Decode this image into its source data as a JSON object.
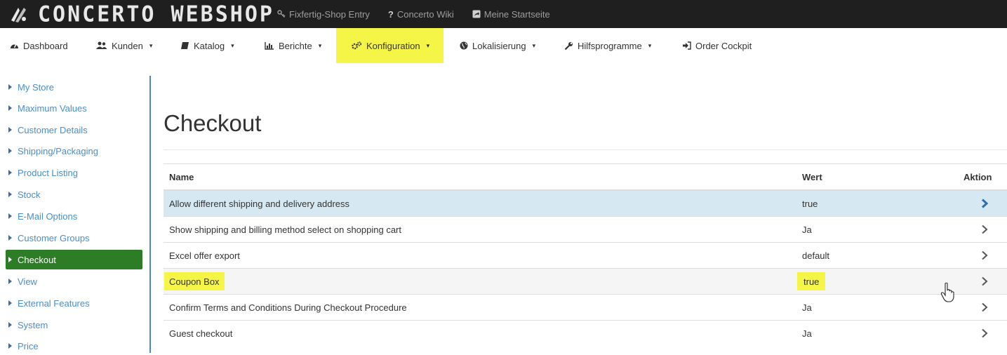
{
  "topbar": {
    "brand": "CONCERTO WEBSHOP",
    "links": [
      {
        "icon": "key-icon",
        "label": "Fixfertig-Shop Entry"
      },
      {
        "icon": "question-icon",
        "label": "Concerto Wiki"
      },
      {
        "icon": "share-icon",
        "label": "Meine Startseite"
      }
    ]
  },
  "nav": {
    "items": [
      {
        "icon": "dashboard-icon",
        "label": "Dashboard",
        "caret": ""
      },
      {
        "icon": "users-icon",
        "label": "Kunden",
        "caret": "▾"
      },
      {
        "icon": "book-icon",
        "label": "Katalog",
        "caret": "▾"
      },
      {
        "icon": "bar-chart-icon",
        "label": "Berichte",
        "caret": "▾"
      },
      {
        "icon": "cogs-icon",
        "label": "Konfiguration",
        "caret": "▾"
      },
      {
        "icon": "globe-icon",
        "label": "Lokalisierung",
        "caret": "▾"
      },
      {
        "icon": "wrench-icon",
        "label": "Hilfsprogramme",
        "caret": "▾"
      },
      {
        "icon": "sign-in-icon",
        "label": "Order Cockpit",
        "caret": ""
      }
    ],
    "active_index": 4
  },
  "sidebar": {
    "items": [
      "My Store",
      "Maximum Values",
      "Customer Details",
      "Shipping/Packaging",
      "Product Listing",
      "Stock",
      "E-Mail Options",
      "Customer Groups",
      "Checkout",
      "View",
      "External Features",
      "System",
      "Price"
    ],
    "active_index": 8
  },
  "page": {
    "title": "Checkout"
  },
  "table": {
    "headers": {
      "name": "Name",
      "value": "Wert",
      "action": "Aktion"
    },
    "rows": [
      {
        "name": "Allow different shipping and delivery address",
        "value": "true"
      },
      {
        "name": "Show shipping and billing method select on shopping cart",
        "value": "Ja"
      },
      {
        "name": "Excel offer export",
        "value": "default"
      },
      {
        "name": "Coupon Box",
        "value": "true"
      },
      {
        "name": "Confirm Terms and Conditions During Checkout Procedure",
        "value": "Ja"
      },
      {
        "name": "Guest checkout",
        "value": "Ja"
      }
    ],
    "selected_row": 0,
    "highlighted_row": 3
  },
  "colors": {
    "topbar": "#1f1f1f",
    "highlight": "#f5f547",
    "sidebar_active": "#2d7d26",
    "link": "#4a8ec9",
    "row_selected": "#d6e9f3",
    "chevron_active": "#2a6fb5"
  }
}
